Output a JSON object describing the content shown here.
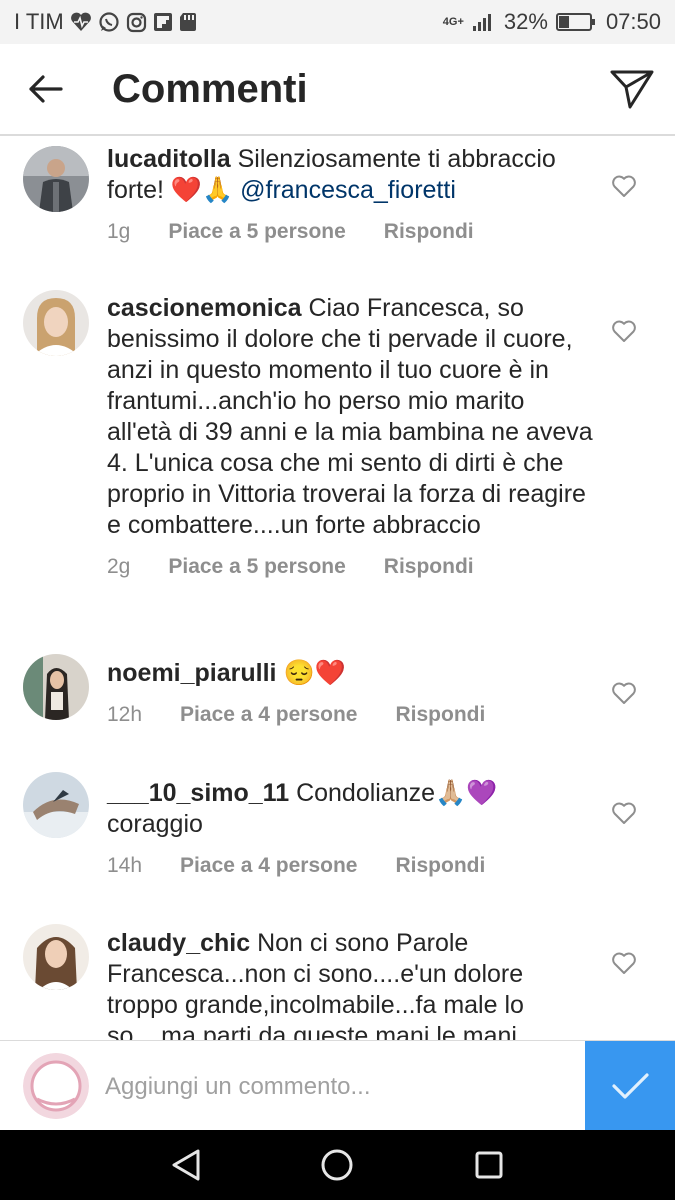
{
  "status_bar": {
    "carrier": "I TIM",
    "network": "4G+",
    "battery_percent": "32%",
    "battery_level": 0.32,
    "time": "07:50",
    "icons": [
      "heart-monitor-icon",
      "whatsapp-icon",
      "instagram-icon",
      "flipboard-icon",
      "sdcard-icon",
      "signal-icon",
      "battery-icon"
    ]
  },
  "header": {
    "title": "Commenti"
  },
  "comments": [
    {
      "username": "lucaditolla",
      "text": "Silenziosamente ti abbraccio forte! ❤️🙏 ",
      "mention": "@francesca_fioretti",
      "time": "1g",
      "likes": "Piace a 5 persone",
      "reply": "Rispondi"
    },
    {
      "username": "cascionemonica",
      "text": "Ciao Francesca, so benissimo il dolore che ti pervade il cuore, anzi in questo momento il tuo cuore è in frantumi...anch'io ho perso mio marito all'età di 39 anni e la mia bambina ne aveva 4. L'unica cosa che mi sento di dirti è che proprio in Vittoria troverai la forza di reagire e combattere....un forte abbraccio",
      "mention": "",
      "time": "2g",
      "likes": "Piace a 5 persone",
      "reply": "Rispondi"
    },
    {
      "username": "noemi_piarulli",
      "text": "😔❤️",
      "mention": "",
      "time": "12h",
      "likes": "Piace a 4 persone",
      "reply": "Rispondi"
    },
    {
      "username": "___10_simo_11",
      "text": "Condolianze🙏🏼💜 coraggio",
      "mention": "",
      "time": "14h",
      "likes": "Piace a 4 persone",
      "reply": "Rispondi"
    },
    {
      "username": "claudy_chic",
      "text": "Non ci sono Parole Francesca...non ci sono....e'un dolore troppo grande,incolmabile...fa male lo so....ma parti da queste mani le mani",
      "mention": "",
      "time": "",
      "likes": "",
      "reply": ""
    }
  ],
  "comment_box": {
    "placeholder": "Aggiungi un commento..."
  },
  "colors": {
    "accent": "#3897f0",
    "like_red": "#ed4956",
    "mention": "#003569",
    "muted": "#8e8e8e"
  }
}
